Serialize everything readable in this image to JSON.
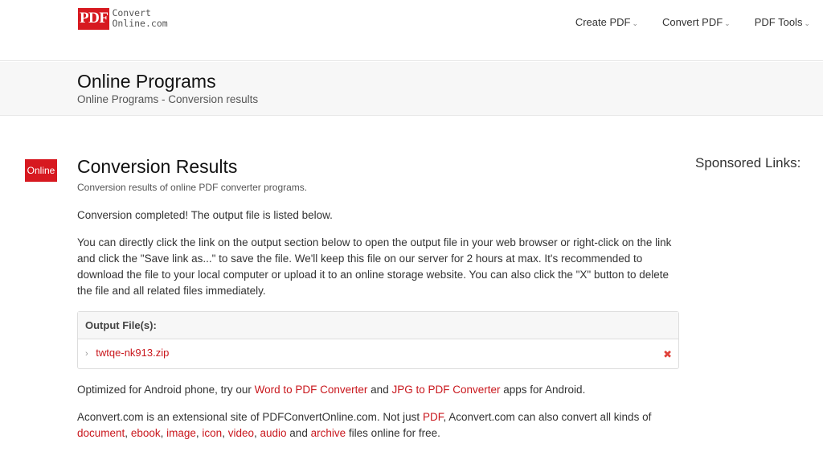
{
  "header": {
    "logo_badge": "PDF",
    "logo_line1": "Convert",
    "logo_line2": "Online.com",
    "nav": [
      {
        "label": "Create PDF"
      },
      {
        "label": "Convert PDF"
      },
      {
        "label": "PDF Tools"
      }
    ],
    "caret_glyph": "⌄"
  },
  "band": {
    "title": "Online Programs",
    "breadcrumb": "Online Programs - Conversion results"
  },
  "side_badge": "Online",
  "main": {
    "title": "Conversion Results",
    "subtitle": "Conversion results of online PDF converter programs.",
    "completed": "Conversion completed! The output file is listed below.",
    "instructions": "You can directly click the link on the output section below to open the output file in your web browser or right-click on the link and click the \"Save link as...\" to save the file. We'll keep this file on our server for 2 hours at max. It's recommended to download the file to your local computer or upload it to an online storage website. You can also click the \"X\" button to delete the file and all related files immediately.",
    "output": {
      "header": "Output File(s):",
      "file_name": "twtqe-nk913.zip",
      "chevron_glyph": "›",
      "delete_glyph": "✖"
    },
    "android": {
      "before": "Optimized for Android phone, try our ",
      "link1": "Word to PDF Converter",
      "middle": " and ",
      "link2": "JPG to PDF Converter",
      "after": " apps for Android."
    },
    "aconvert": {
      "t1": "Aconvert.com is an extensional site of PDFConvertOnline.com. Not just ",
      "pdf": "PDF",
      "t2": ", Aconvert.com can also convert all kinds of ",
      "document": "document",
      "s1": ", ",
      "ebook": "ebook",
      "s2": ", ",
      "image": "image",
      "s3": ", ",
      "icon": "icon",
      "s4": ", ",
      "video": "video",
      "s5": ", ",
      "audio": "audio",
      "s6": " and ",
      "archive": "archive",
      "t3": " files online for free."
    }
  },
  "sidebar": {
    "sponsored": "Sponsored Links:"
  },
  "colors": {
    "brand_red": "#d71920",
    "link_red": "#c9171d",
    "delete_red": "#e0413a"
  }
}
